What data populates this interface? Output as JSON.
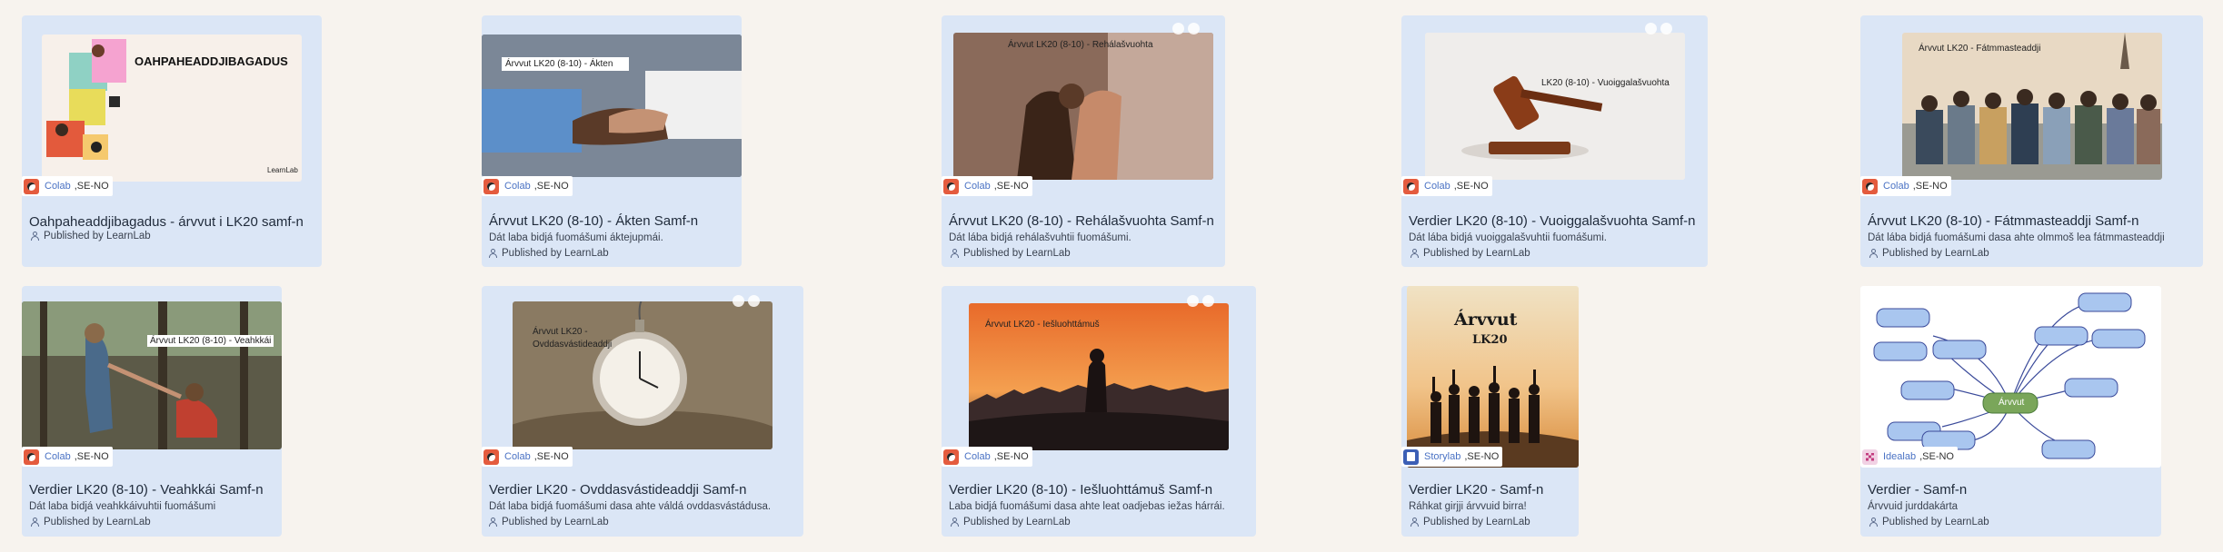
{
  "cards": [
    {
      "title": "Oahpaheaddjibagadus - árvvut i LK20 samf-n",
      "description": "",
      "published": "Published by LearnLab",
      "app": "Colab",
      "locale": ",SE-NO",
      "thumb_text": "OAHPAHEADDJIBAGADUS",
      "thumb_brand": "LearnLab"
    },
    {
      "title": "Árvvut LK20 (8-10) - Ákten Samf-n",
      "description": "Dát laba bidjá fuomášumi áktejupmái.",
      "published": "Published by LearnLab",
      "app": "Colab",
      "locale": ",SE-NO",
      "thumb_text": "Árvvut LK20 (8-10) - Ákten"
    },
    {
      "title": "Árvvut LK20 (8-10) - Rehálašvuohta Samf-n",
      "description": "Dát lába bidjá rehálašvuhtii fuomášumi.",
      "published": "Published by LearnLab",
      "app": "Colab",
      "locale": ",SE-NO",
      "thumb_text": "Árvvut LK20 (8-10) - Rehálašvuohta"
    },
    {
      "title": "Verdier LK20 (8-10) - Vuoiggalašvuohta Samf-n",
      "description": "Dát lába bidjá vuoiggalašvuhtii fuomášumi.",
      "published": "Published by LearnLab",
      "app": "Colab",
      "locale": ",SE-NO",
      "thumb_text": "LK20 (8-10) - Vuoiggalašvuohta"
    },
    {
      "title": "Árvvut LK20 (8-10) - Fátmmasteaddji Samf-n",
      "description": "Dát lába bidjá fuomášumi dasa ahte olmmoš lea fátmmasteaddji",
      "published": "Published by LearnLab",
      "app": "Colab",
      "locale": ",SE-NO",
      "thumb_text": "Árvvut LK20 - Fátmmasteaddji"
    },
    {
      "title": "Verdier LK20 (8-10) - Veahkkái Samf-n",
      "description": "Dát laba bidjá veahkkáivuhtii fuomášumi",
      "published": "Published by LearnLab",
      "app": "Colab",
      "locale": ",SE-NO",
      "thumb_text": "Árvvut LK20 (8-10) - Veahkkái"
    },
    {
      "title": "Verdier LK20 - Ovddasvástideaddji Samf-n",
      "description": "Dát laba bidjá fuomášumi dasa ahte váldá ovddasvástádusa.",
      "published": "Published by LearnLab",
      "app": "Colab",
      "locale": ",SE-NO",
      "thumb_text": "Árvvut LK20 -",
      "thumb_text2": "Ovddasvástideaddji"
    },
    {
      "title": "Verdier LK20 (8-10) - Iešluohttámuš Samf-n",
      "description": "Laba bidjá fuomášumi dasa ahte leat oadjebas iežas hárrái.",
      "published": "Published by LearnLab",
      "app": "Colab",
      "locale": ",SE-NO",
      "thumb_text": "Árvvut LK20 - Iešluohttámuš"
    },
    {
      "title": "Verdier LK20 - Samf-n",
      "description": "Ráhkat girjji árvvuid birra!",
      "published": "Published by LearnLab",
      "app": "Storylab",
      "locale": ",SE-NO",
      "thumb_text": "Árvvut",
      "thumb_text2": "LK20"
    },
    {
      "title": "Verdier - Samf-n",
      "description": "Árvvuid jurddakárta",
      "published": "Published by LearnLab",
      "app": "Idealab",
      "locale": ",SE-NO",
      "thumb_text": "Árvvut"
    }
  ]
}
